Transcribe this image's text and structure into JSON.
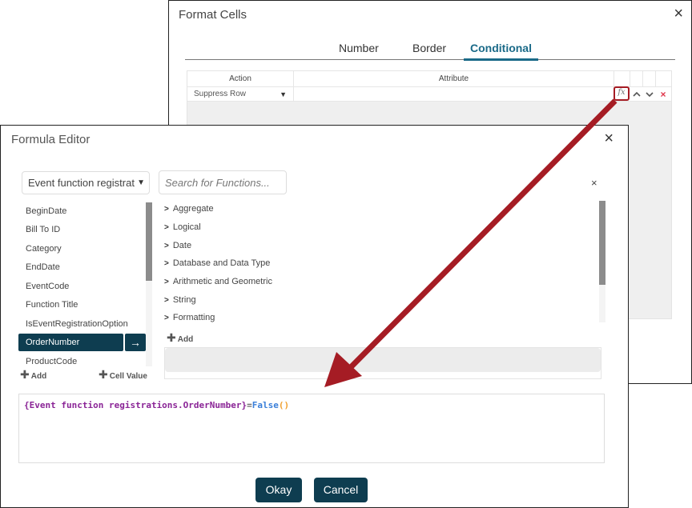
{
  "format_cells": {
    "title": "Format Cells",
    "close_icon": "×",
    "tabs": [
      {
        "label": "Number",
        "active": false
      },
      {
        "label": "Border",
        "active": false
      },
      {
        "label": "Conditional",
        "active": true
      }
    ],
    "grid": {
      "columns": [
        "Action",
        "Attribute"
      ],
      "rows": [
        {
          "action": "Suppress Row",
          "attribute": ""
        }
      ],
      "row_icons": {
        "formula": "fx",
        "move_up": "^",
        "move_down": "v",
        "delete": "×"
      }
    }
  },
  "formula_editor": {
    "title": "Formula Editor",
    "close_icon": "×",
    "table_select": {
      "value": "Event function registrat",
      "caret": "▼"
    },
    "search": {
      "placeholder": "Search for Functions...",
      "value": "",
      "clear_icon": "×"
    },
    "fields": [
      {
        "label": "BeginDate",
        "selected": false
      },
      {
        "label": "Bill To ID",
        "selected": false
      },
      {
        "label": "Category",
        "selected": false
      },
      {
        "label": "EndDate",
        "selected": false
      },
      {
        "label": "EventCode",
        "selected": false
      },
      {
        "label": "Function Title",
        "selected": false
      },
      {
        "label": "IsEventRegistrationOption",
        "selected": false
      },
      {
        "label": "OrderNumber",
        "selected": true
      },
      {
        "label": "ProductCode",
        "selected": false
      }
    ],
    "field_insert_icon": "→",
    "field_actions": {
      "add_label": "Add",
      "cell_value_label": "Cell Value"
    },
    "function_categories": [
      "Aggregate",
      "Logical",
      "Date",
      "Database and Data Type",
      "Arithmetic and Geometric",
      "String",
      "Formatting"
    ],
    "function_add_label": "Add",
    "formula_tokens": [
      {
        "text": "{Event function registrations.OrderNumber}",
        "type": "field"
      },
      {
        "text": "=",
        "type": "op"
      },
      {
        "text": "False",
        "type": "func"
      },
      {
        "text": "()",
        "type": "paren"
      }
    ],
    "buttons": {
      "okay": "Okay",
      "cancel": "Cancel"
    }
  },
  "annotation": {
    "color": "#a51c24",
    "description": "arrow from fx button to formula box"
  },
  "colors": {
    "accent": "#1a6a88",
    "button_bg": "#0e3d50",
    "highlight": "#a51c24",
    "delete_icon": "#e0354a"
  }
}
